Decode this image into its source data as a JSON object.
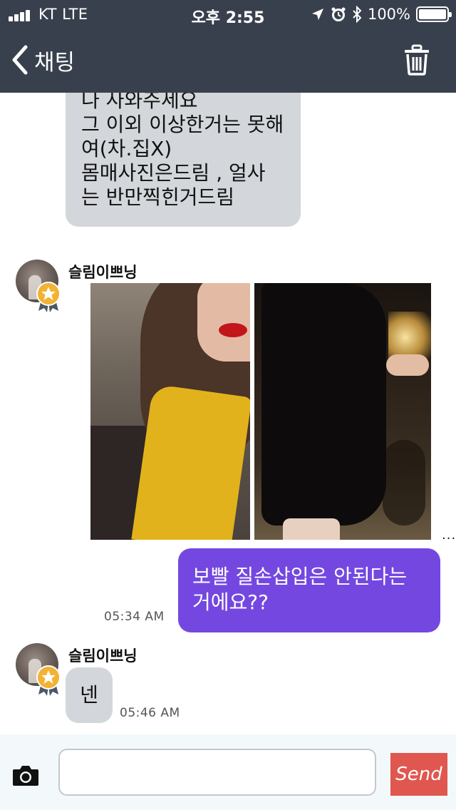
{
  "status_bar": {
    "carrier": "KT   LTE",
    "time": "오후 2:55",
    "battery_text": "100%",
    "battery_level": 100
  },
  "nav": {
    "back_label": "채팅",
    "back_icon": "chevron-left-icon",
    "trash_icon": "trash-icon"
  },
  "messages": [
    {
      "type": "received_text",
      "lines": [
        "나 사와주세요",
        "그 이외 이상한거는 못해",
        "여(차.집X)",
        "몸매사진은드림 , 얼사",
        "는 반만찍힌거드림"
      ]
    },
    {
      "type": "received_image",
      "sender": "슬림이쁘닝",
      "more": "..."
    },
    {
      "type": "sent_text",
      "lines": [
        "보빨 질손삽입은 안된다는",
        "거에요??"
      ],
      "time": "05:34 AM"
    },
    {
      "type": "received_text",
      "sender": "슬림이쁘닝",
      "text": "넨",
      "time": "05:46 AM"
    }
  ],
  "input": {
    "value": "",
    "camera_icon": "camera-icon",
    "send_label": "Send"
  },
  "colors": {
    "topbar": "#39404d",
    "sent_bubble": "#7448e0",
    "received_bubble": "#d3d6da",
    "send_button": "#e0574f",
    "input_bar": "#f3f9fb"
  }
}
